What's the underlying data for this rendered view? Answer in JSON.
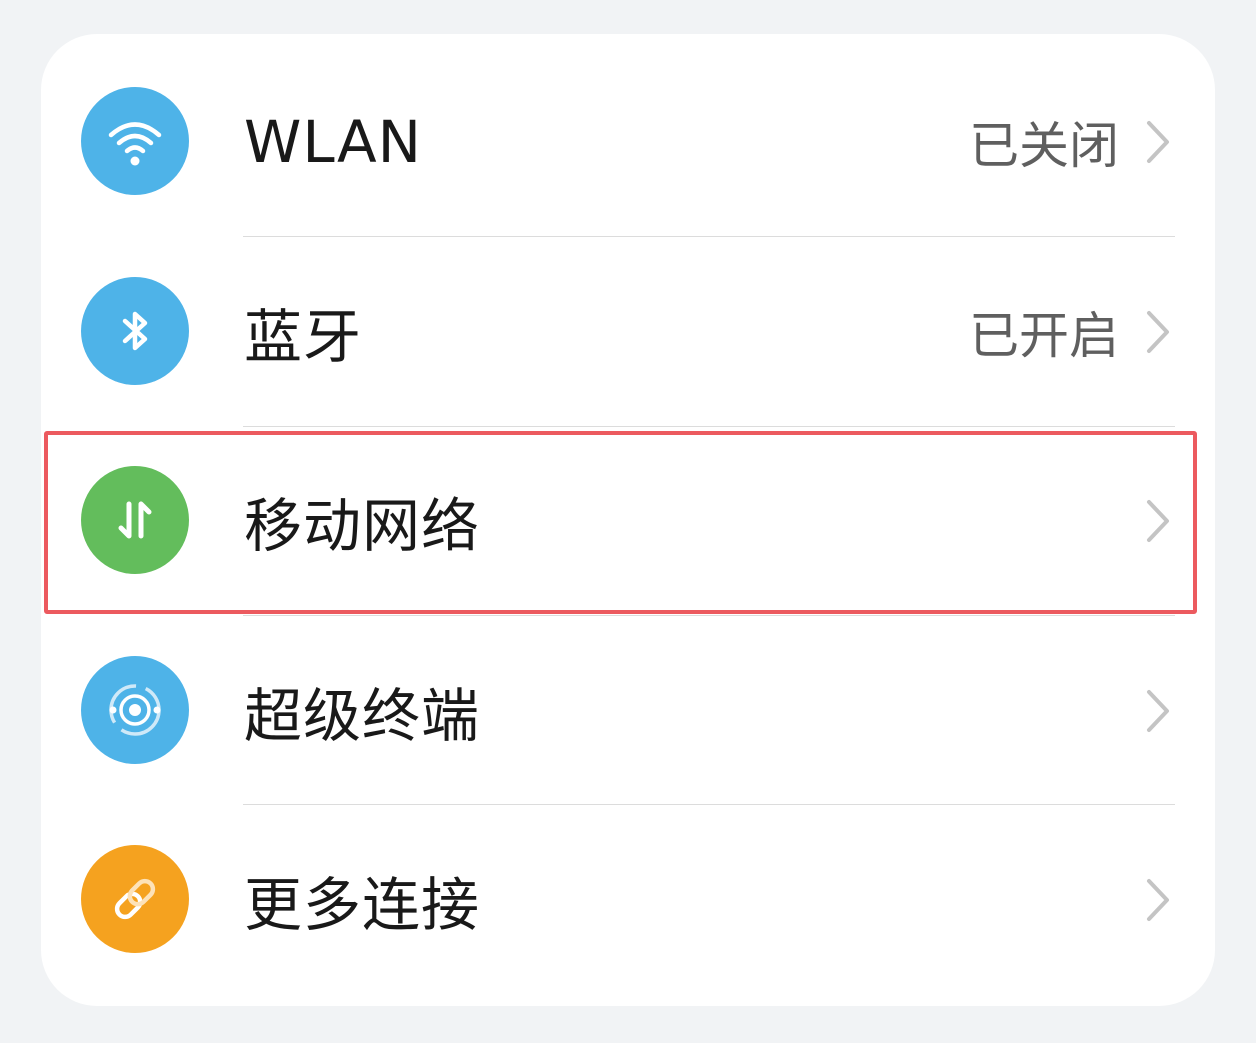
{
  "settings": {
    "items": [
      {
        "label": "WLAN",
        "status": "已关闭",
        "icon": "wifi-icon",
        "icon_color": "#4eb3e8"
      },
      {
        "label": "蓝牙",
        "status": "已开启",
        "icon": "bluetooth-icon",
        "icon_color": "#4eb3e8"
      },
      {
        "label": "移动网络",
        "status": "",
        "icon": "mobile-data-icon",
        "icon_color": "#63bd5c"
      },
      {
        "label": "超级终端",
        "status": "",
        "icon": "super-device-icon",
        "icon_color": "#4eb3e8"
      },
      {
        "label": "更多连接",
        "status": "",
        "icon": "link-icon",
        "icon_color": "#f5a21f"
      }
    ]
  },
  "colors": {
    "highlight": "#ec5a5f",
    "background": "#f1f3f5",
    "card": "#ffffff"
  }
}
